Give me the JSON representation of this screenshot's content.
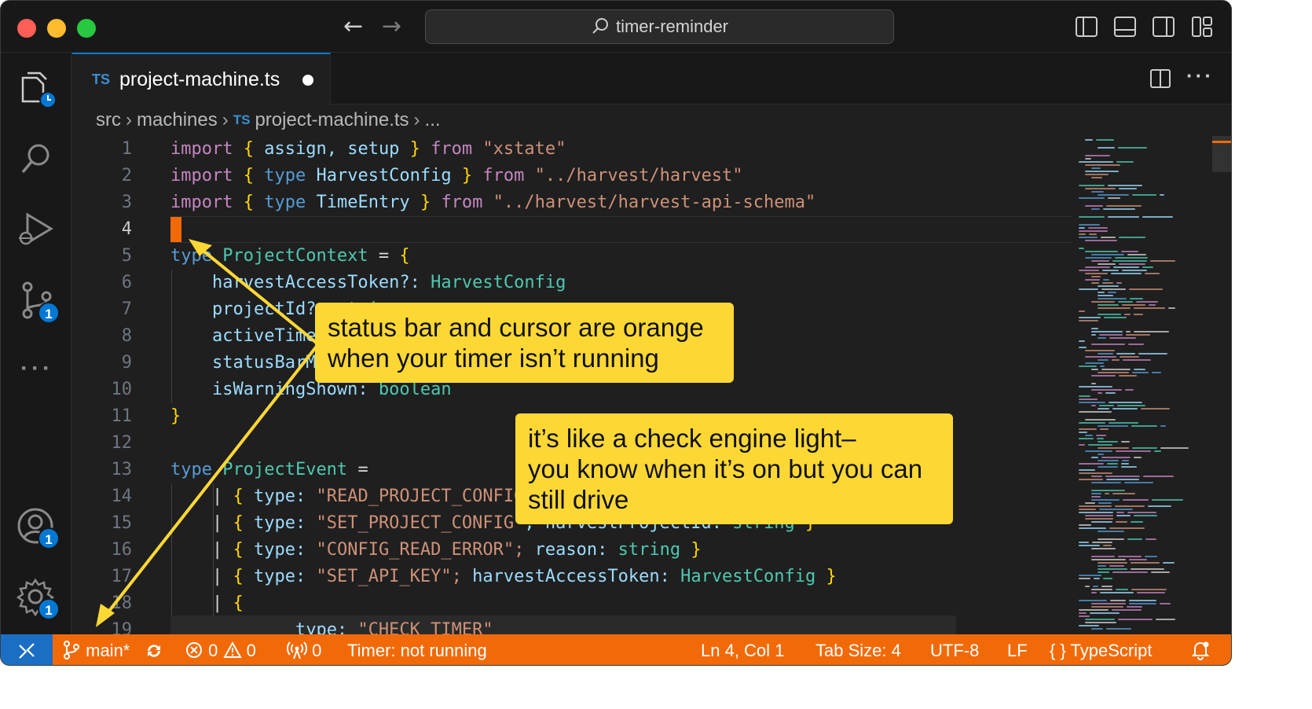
{
  "window": {
    "search_title": "timer-reminder"
  },
  "tab": {
    "lang": "TS",
    "name": "project-machine.ts"
  },
  "breadcrumb": {
    "parts": [
      "src",
      "machines",
      "project-machine.ts",
      "..."
    ],
    "lang": "TS"
  },
  "activity_badges": {
    "source_control": "1",
    "accounts": "1",
    "settings": "1"
  },
  "editor": {
    "active_line": 4,
    "line_numbers": [
      "1",
      "2",
      "3",
      "4",
      "5",
      "6",
      "7",
      "8",
      "9",
      "10",
      "11",
      "12",
      "13",
      "14",
      "15",
      "16",
      "17",
      "18",
      "19"
    ]
  },
  "code_tokens": {
    "l1": [
      "import",
      "{",
      "assign,",
      "setup",
      "}",
      "from",
      "\"xstate\""
    ],
    "l2": [
      "import",
      "{",
      "type",
      "HarvestConfig",
      "}",
      "from",
      "\"../harvest/harvest\""
    ],
    "l3": [
      "import",
      "{",
      "type",
      "TimeEntry",
      "}",
      "from",
      "\"../harvest/harvest-api-schema\""
    ],
    "l5": [
      "type",
      "ProjectContext",
      "=",
      "{"
    ],
    "l6": [
      "harvestAccessToken?:",
      "HarvestConfig"
    ],
    "l7": [
      "projectId?:",
      "string"
    ],
    "l8": [
      "activeTimer"
    ],
    "l9": [
      "statusBarMessage"
    ],
    "l10": [
      "isWarningShown:",
      "boolean"
    ],
    "l11": [
      "}"
    ],
    "l13": [
      "type",
      "ProjectEvent",
      "="
    ],
    "l14": [
      "|",
      "{",
      "type:",
      "\"READ_PROJECT_CONFIG\""
    ],
    "l15": [
      "|",
      "{",
      "type:",
      "\"SET_PROJECT_CONFIG\"",
      "; harvestProjectId:",
      "string",
      "}"
    ],
    "l16": [
      "|",
      "{",
      "type:",
      "\"CONFIG_READ_ERROR\";",
      "reason:",
      "string",
      "}"
    ],
    "l17": [
      "|",
      "{",
      "type:",
      "\"SET_API_KEY\";",
      "harvestAccessToken:",
      "HarvestConfig",
      "}"
    ],
    "l18": [
      "|",
      "{"
    ],
    "l19": [
      "type:",
      "\"CHECK_TIMER\""
    ]
  },
  "statusbar": {
    "branch": "main*",
    "errors": "0",
    "warnings": "0",
    "ports": "0",
    "timer": "Timer: not running",
    "position": "Ln 4, Col 1",
    "tab_size": "Tab Size: 4",
    "encoding": "UTF-8",
    "eol": "LF",
    "language": "TypeScript",
    "background_color": "#f26a07",
    "remote_color": "#1a6fc4"
  },
  "callouts": {
    "first_line1": "status bar and cursor are orange",
    "first_line2": "when your timer isn’t running",
    "second_line1": "it’s like a check engine light–",
    "second_line2": "you know when it’s on but you can",
    "second_line3": "still drive",
    "color": "#fdd835"
  },
  "colors": {
    "cursor": "#f26a07",
    "accent": "#0078d4"
  }
}
